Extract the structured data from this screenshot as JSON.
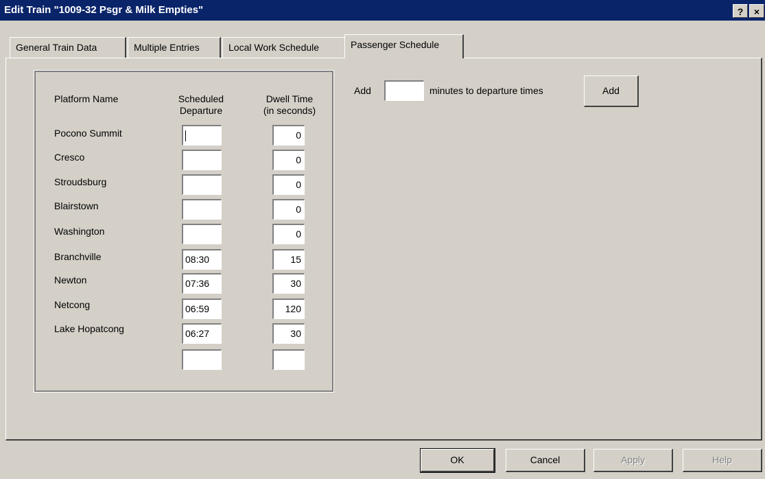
{
  "window": {
    "title": "Edit Train \"1009-32  Psgr & Milk Empties\"",
    "help_glyph": "?",
    "close_glyph": "×"
  },
  "tabs": [
    {
      "label": "General Train Data"
    },
    {
      "label": "Multiple Entries"
    },
    {
      "label": "Local Work Schedule"
    },
    {
      "label": "Passenger Schedule",
      "active": true
    }
  ],
  "schedule": {
    "header_platform": "Platform Name",
    "header_departure_1": "Scheduled",
    "header_departure_2": "Departure",
    "header_dwell_1": "Dwell Time",
    "header_dwell_2": "(in seconds)",
    "rows": [
      {
        "platform": "Pocono Summit",
        "departure": "",
        "dwell": "0"
      },
      {
        "platform": "Cresco",
        "departure": "",
        "dwell": "0"
      },
      {
        "platform": "Stroudsburg",
        "departure": "",
        "dwell": "0"
      },
      {
        "platform": "Blairstown",
        "departure": "",
        "dwell": "0"
      },
      {
        "platform": "Washington",
        "departure": "",
        "dwell": "0"
      },
      {
        "platform": "Branchville",
        "departure": "08:30",
        "dwell": "15"
      },
      {
        "platform": "Newton",
        "departure": "07:36",
        "dwell": "30"
      },
      {
        "platform": "Netcong",
        "departure": "06:59",
        "dwell": "120"
      },
      {
        "platform": "Lake Hopatcong",
        "departure": "06:27",
        "dwell": "30"
      },
      {
        "platform": "",
        "departure": "",
        "dwell": ""
      }
    ]
  },
  "adjust": {
    "prefix": "Add",
    "minutes_value": "",
    "suffix": "minutes to departure times",
    "button": "Add"
  },
  "footer": {
    "ok": "OK",
    "cancel": "Cancel",
    "apply": "Apply",
    "help": "Help"
  },
  "colors": {
    "titlebar": "#0a246a",
    "face": "#d4d0c8"
  }
}
